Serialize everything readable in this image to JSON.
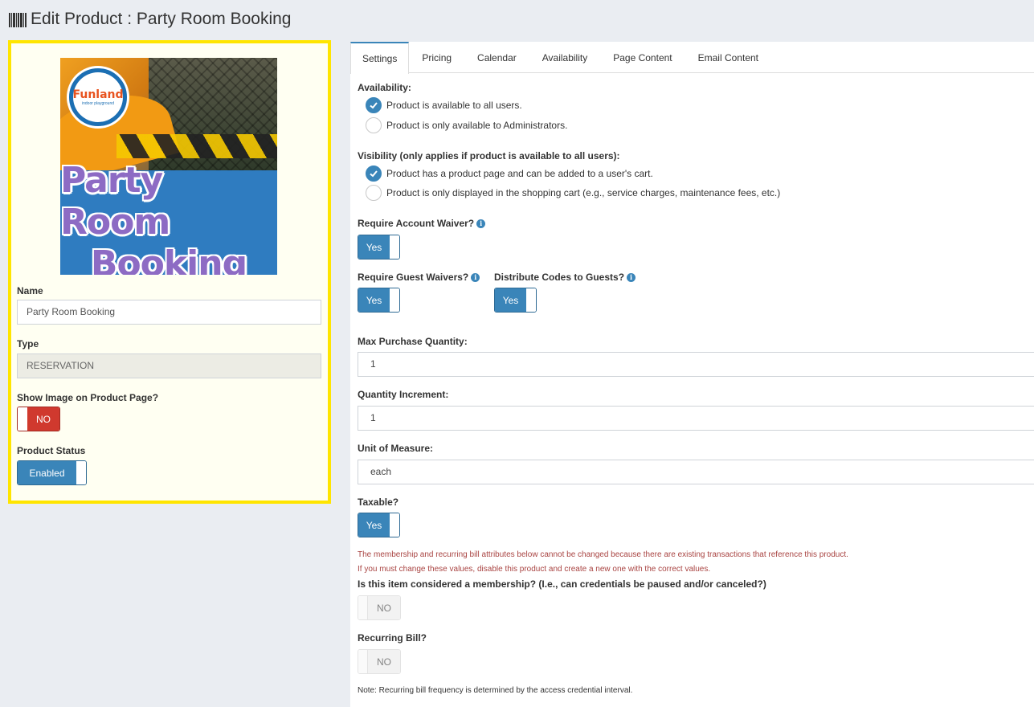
{
  "page": {
    "title": "Edit Product : Party Room Booking",
    "title_icon": "barcode-icon"
  },
  "left": {
    "image": {
      "logo_text": "Funland",
      "logo_subtext": "indoor playground",
      "line1": "Party Room",
      "line2": "Booking"
    },
    "name_label": "Name",
    "name_value": "Party Room Booking",
    "type_label": "Type",
    "type_value": "RESERVATION",
    "show_image_label": "Show Image on Product Page?",
    "show_image_value": "NO",
    "status_label": "Product Status",
    "status_value": "Enabled"
  },
  "tabs": [
    "Settings",
    "Pricing",
    "Calendar",
    "Availability",
    "Page Content",
    "Email Content"
  ],
  "settings": {
    "availability_label": "Availability:",
    "availability_options": [
      {
        "label": "Product is available to all users.",
        "checked": true
      },
      {
        "label": "Product is only available to Administrators.",
        "checked": false
      }
    ],
    "visibility_label": "Visibility (only applies if product is available to all users):",
    "visibility_options": [
      {
        "label": "Product has a product page and can be added to a user's cart.",
        "checked": true
      },
      {
        "label": "Product is only displayed in the shopping cart (e.g., service charges, maintenance fees, etc.)",
        "checked": false
      }
    ],
    "require_account_waiver_label": "Require Account Waiver?",
    "require_account_waiver_value": "Yes",
    "require_guest_waivers_label": "Require Guest Waivers?",
    "require_guest_waivers_value": "Yes",
    "distribute_codes_label": "Distribute Codes to Guests?",
    "distribute_codes_value": "Yes",
    "max_purchase_label": "Max Purchase Quantity:",
    "max_purchase_value": "1",
    "quantity_increment_label": "Quantity Increment:",
    "quantity_increment_value": "1",
    "unit_label": "Unit of Measure:",
    "unit_value": "each",
    "taxable_label": "Taxable?",
    "taxable_value": "Yes",
    "warning_line1": "The membership and recurring bill attributes below cannot be changed because there are existing transactions that reference this product.",
    "warning_line2": "If you must change these values, disable this product and create a new one with the correct values.",
    "membership_label": "Is this item considered a membership? (I.e., can credentials be paused and/or canceled?)",
    "membership_value": "NO",
    "recurring_label": "Recurring Bill?",
    "recurring_value": "NO",
    "note": "Note: Recurring bill frequency is determined by the access credential interval."
  },
  "colors": {
    "accent": "#3a85b9",
    "highlight_border": "#ffe500",
    "toggle_off_red": "#d0392e",
    "warning_text": "#a94442"
  }
}
